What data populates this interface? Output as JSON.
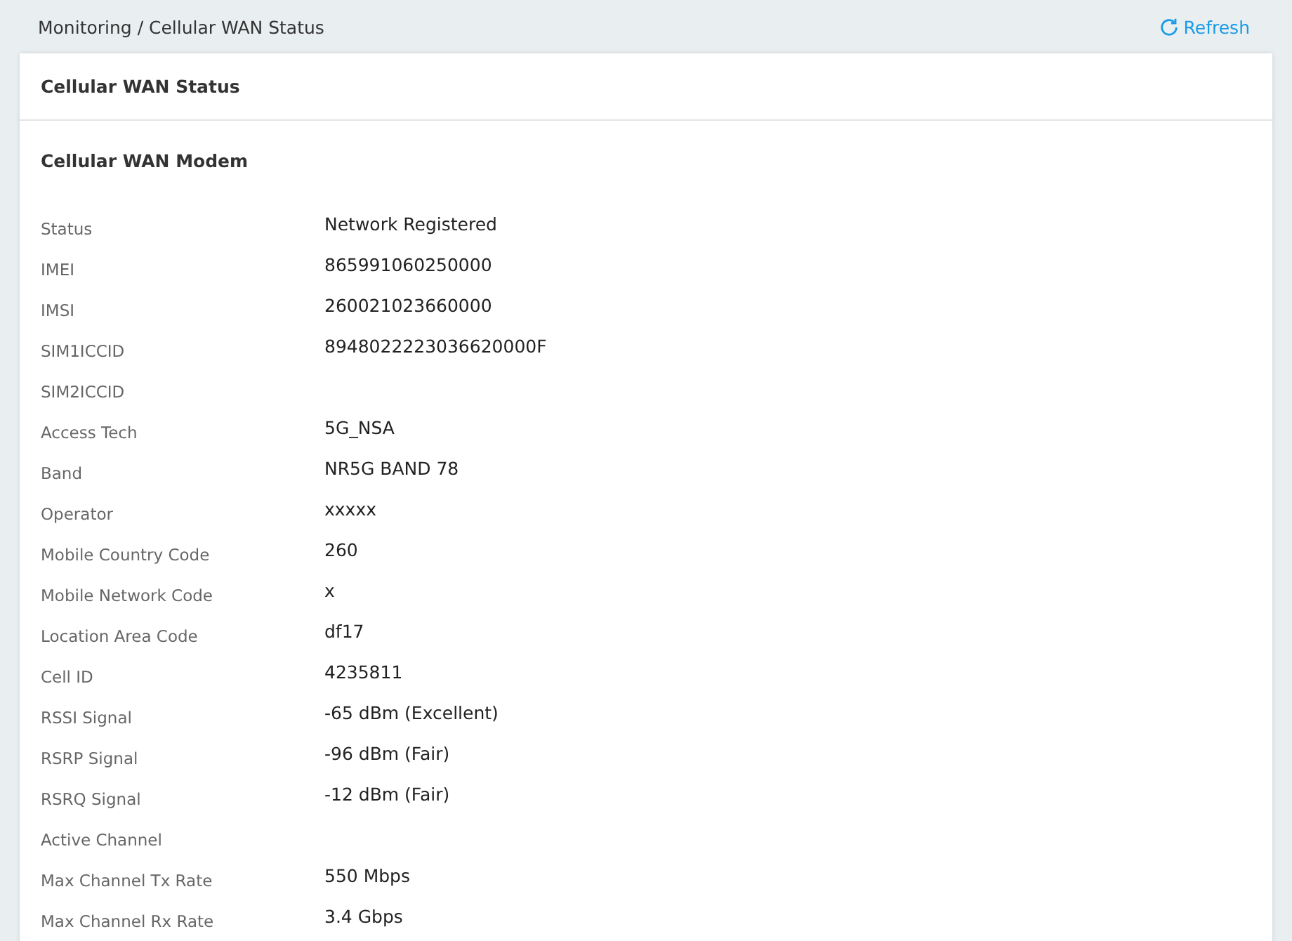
{
  "breadcrumb": "Monitoring / Cellular WAN Status",
  "refresh_button": {
    "label": "Refresh"
  },
  "card": {
    "title": "Cellular WAN Status",
    "section_title": "Cellular WAN Modem",
    "rows": [
      {
        "label": "Status",
        "value": "Network Registered"
      },
      {
        "label": "IMEI",
        "value": "865991060250000"
      },
      {
        "label": "IMSI",
        "value": "260021023660000"
      },
      {
        "label": "SIM1ICCID",
        "value": "8948022223036620000F"
      },
      {
        "label": "SIM2ICCID"
      },
      {
        "label": "Access Tech",
        "value": "5G_NSA"
      },
      {
        "label": "Band",
        "value": "NR5G BAND 78"
      },
      {
        "label": "Operator",
        "value": "xxxxx"
      },
      {
        "label": "Mobile Country Code",
        "value": "260"
      },
      {
        "label": "Mobile Network Code",
        "value": "x"
      },
      {
        "label": "Location Area Code",
        "value": "df17"
      },
      {
        "label": "Cell ID",
        "value": "4235811"
      },
      {
        "label": "RSSI Signal",
        "value": "-65 dBm (Excellent)"
      },
      {
        "label": "RSRP Signal",
        "value": "-96 dBm (Fair)"
      },
      {
        "label": "RSRQ Signal",
        "value": "-12 dBm (Fair)"
      },
      {
        "label": "Active Channel"
      },
      {
        "label": "Max Channel Tx Rate",
        "value": "550 Mbps"
      },
      {
        "label": "Max Channel Rx Rate",
        "value": "3.4 Gbps"
      }
    ]
  }
}
